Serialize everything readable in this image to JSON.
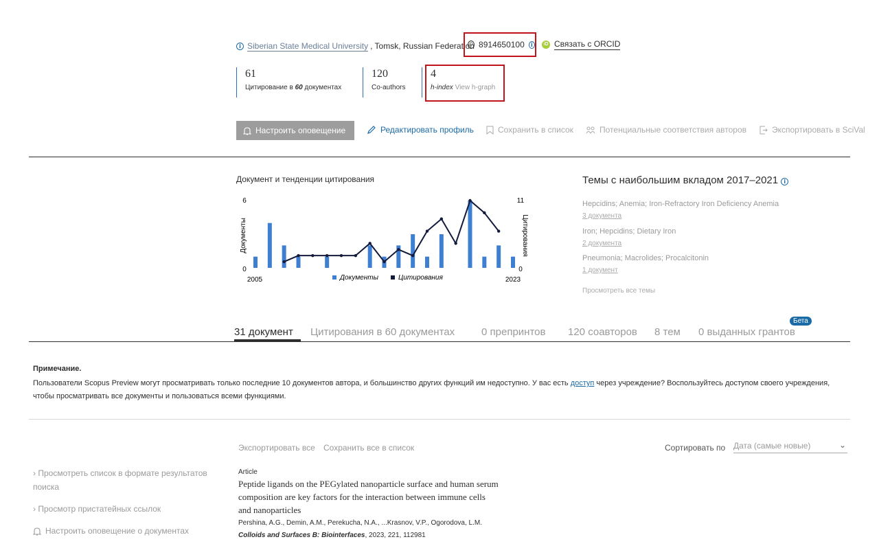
{
  "profile": {
    "affiliation": "Siberian State Medical University",
    "location": ", Tomsk, Russian Federation",
    "author_id": "8914650100",
    "orcid_label": "Связать с ORCID"
  },
  "metrics": [
    {
      "value": "61",
      "label_pre": "Цитирование в ",
      "label_em": "60",
      "label_post": " документах"
    },
    {
      "value": "120",
      "label": "Co-authors"
    },
    {
      "value": "4",
      "label_em": "h-index",
      "link": "View h-graph"
    }
  ],
  "actions": {
    "alert": "Настроить оповещение",
    "edit": "Редактировать профиль",
    "save": "Сохранить в список",
    "matches": "Потенциальные соответствия авторов",
    "export": "Экспортировать в SciVal"
  },
  "chart_data": {
    "type": "bar+line",
    "title": "Документ и тенденции цитирования",
    "x_range": [
      2005,
      2023
    ],
    "x_tick_labels": [
      "2005",
      "2023"
    ],
    "left_axis": {
      "label": "Документы",
      "ylim": [
        0,
        6
      ],
      "tick_labels": [
        "6",
        "0"
      ]
    },
    "right_axis": {
      "label": "Цитирования",
      "ylim": [
        0,
        11
      ],
      "tick_labels": [
        "11",
        "0"
      ]
    },
    "years": [
      2005,
      2006,
      2007,
      2008,
      2009,
      2010,
      2011,
      2012,
      2013,
      2014,
      2015,
      2016,
      2017,
      2018,
      2019,
      2020,
      2021,
      2022,
      2023
    ],
    "series": [
      {
        "name": "Документы",
        "type": "bar",
        "color": "#3f7fd1",
        "values": [
          1,
          4,
          2,
          1,
          0,
          1,
          0,
          0,
          2,
          1,
          2,
          3,
          1,
          3,
          0,
          6,
          1,
          2,
          1
        ]
      },
      {
        "name": "Цитирования",
        "type": "line",
        "color": "#141a3c",
        "points": [
          [
            2007,
            1
          ],
          [
            2008,
            2
          ],
          [
            2009,
            2
          ],
          [
            2010,
            2
          ],
          [
            2011,
            2
          ],
          [
            2012,
            2
          ],
          [
            2013,
            4
          ],
          [
            2014,
            1
          ],
          [
            2015,
            3
          ],
          [
            2016,
            2
          ],
          [
            2017,
            6
          ],
          [
            2018,
            8
          ],
          [
            2019,
            4
          ],
          [
            2020,
            11
          ],
          [
            2021,
            9
          ],
          [
            2022,
            6
          ]
        ]
      }
    ],
    "legend": [
      "Документы",
      "Цитирования"
    ],
    "legend_position": "bottom"
  },
  "topics": {
    "title": "Темы с наибольшим вкладом 2017–2021",
    "items": [
      {
        "name": "Hepcidins; Anemia; Iron-Refractory Iron Deficiency Anemia",
        "docs": "3 документа"
      },
      {
        "name": "Iron; Hepcidins; Dietary Iron",
        "docs": "2 документа"
      },
      {
        "name": "Pneumonia; Macrolides; Procalcitonin",
        "docs": "1 документ"
      }
    ],
    "view_all": "Просмотреть все темы"
  },
  "tabs": [
    "31 документ",
    "Цитирования в 60 документах",
    "0 препринтов",
    "120 соавторов",
    "8 тем",
    "0 выданных грантов"
  ],
  "beta": "Бета",
  "note": {
    "title": "Примечание.",
    "text_pre": "Пользователи Scopus Preview могут просматривать только последние 10 документов автора, и большинство других функций им недоступно. У вас есть ",
    "link": "доступ",
    "text_post": " через учреждение? Воспользуйтесь доступом своего учреждения, чтобы просматривать все документы и пользоваться всеми функциями."
  },
  "list_tools": {
    "export_all": "Экспортировать все",
    "save_all": "Сохранить все в список",
    "sort_label": "Сортировать по",
    "sort_value": "Дата (самые новые)"
  },
  "side_links": [
    "Просмотреть список в формате результатов поиска",
    "Просмотр пристатейных ссылок",
    "Настроить оповещение о документах"
  ],
  "document": {
    "type": "Article",
    "title": "Peptide ligands on the PEGylated nanoparticle surface and human serum composition are key factors for the interaction between immune cells and nanoparticles",
    "authors": "Pershina, A.G., Demin, A.M., Perekucha, N.A., ...Krasnov, V.P., Ogorodova, L.M.",
    "journal": "Colloids and Surfaces B: Biointerfaces",
    "citation": ", 2023, 221, 112981"
  }
}
